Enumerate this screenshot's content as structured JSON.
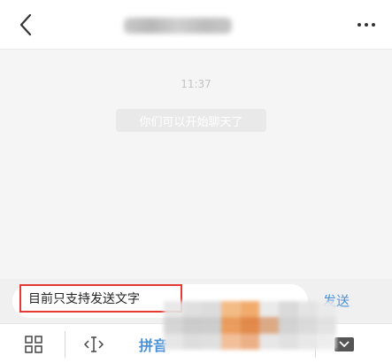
{
  "header": {
    "back_icon": "chevron-left-icon",
    "more_icon": "ellipsis-icon"
  },
  "chat": {
    "timestamp": "11:37",
    "system_message": "你们可以开始聊天了"
  },
  "input": {
    "value": "目前只支持发送文字",
    "send_label": "发送"
  },
  "keyboard_toolbar": {
    "pinyin_label": "拼音"
  },
  "colors": {
    "accent": "#4a90d9",
    "highlight_border": "#e53935"
  }
}
